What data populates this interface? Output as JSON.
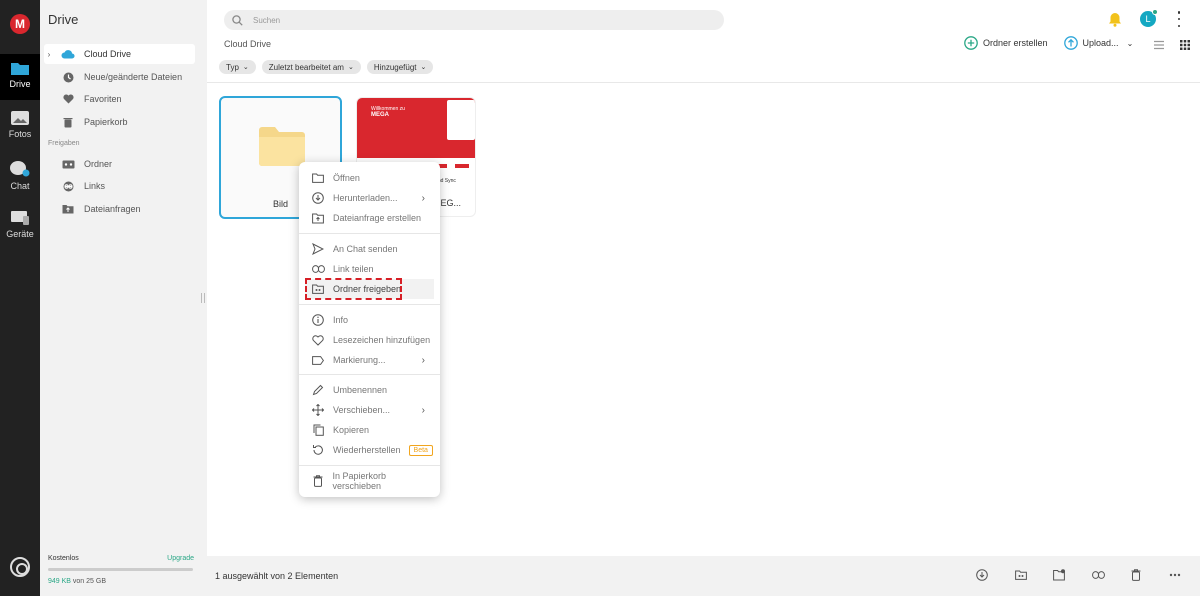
{
  "rail": {
    "logo": "M",
    "items": [
      {
        "label": "Drive"
      },
      {
        "label": "Fotos"
      },
      {
        "label": "Chat"
      },
      {
        "label": "Geräte"
      }
    ]
  },
  "sidebar": {
    "title": "Drive",
    "items": [
      {
        "label": "Cloud Drive"
      },
      {
        "label": "Neue/geänderte Dateien"
      },
      {
        "label": "Favoriten"
      },
      {
        "label": "Papierkorb"
      }
    ],
    "section_label": "Freigaben",
    "shared_items": [
      {
        "label": "Ordner"
      },
      {
        "label": "Links"
      },
      {
        "label": "Dateianfragen"
      }
    ],
    "plan": "Kostenlos",
    "upgrade": "Upgrade",
    "usage_used": "949 KB",
    "usage_rest": " von 25 GB",
    "usage_fraction": 4e-05
  },
  "topbar": {
    "search_placeholder": "Suchen",
    "avatar_letter": "L"
  },
  "breadcrumb": "Cloud Drive",
  "actions": {
    "create_folder": "Ordner erstellen",
    "upload": "Upload..."
  },
  "filters": [
    "Typ",
    "Zuletzt bearbeitet am",
    "Hinzugefügt"
  ],
  "files": [
    {
      "name": "Bild"
    },
    {
      "name_partial": "EG...",
      "thumb_title_1": "Willkommen zu",
      "thumb_title_2": "MEGA",
      "thumb_right": "r und Sync"
    }
  ],
  "context_menu": {
    "group1": [
      "Öffnen",
      "Herunterladen...",
      "Dateianfrage erstellen"
    ],
    "group2": [
      "An Chat senden",
      "Link teilen",
      "Ordner freigeben"
    ],
    "group3": [
      "Info",
      "Lesezeichen hinzufügen",
      "Markierung..."
    ],
    "group4": [
      "Umbenennen",
      "Verschieben...",
      "Kopieren",
      "Wiederherstellen"
    ],
    "beta": "Beta",
    "group5": [
      "In Papierkorb verschieben"
    ]
  },
  "footer": {
    "selection": "1 ausgewählt von 2 Elementen"
  },
  "colors": {
    "accent": "#2aa786",
    "brand": "#d9272e",
    "selection_border": "#2fa6d9",
    "highlight_dash": "#d61f26"
  }
}
